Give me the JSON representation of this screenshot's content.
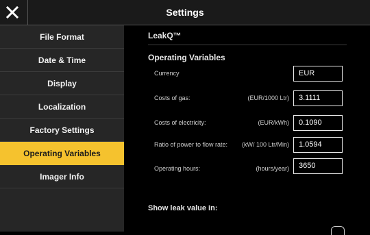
{
  "header": {
    "title": "Settings"
  },
  "sidebar": {
    "items": [
      {
        "label": "File Format"
      },
      {
        "label": "Date & Time"
      },
      {
        "label": "Display"
      },
      {
        "label": "Localization"
      },
      {
        "label": "Factory Settings"
      },
      {
        "label": "Operating Variables"
      },
      {
        "label": "Imager Info"
      }
    ],
    "active_index": 5
  },
  "content": {
    "product": "LeakQ™",
    "section_title": "Operating Variables",
    "fields": [
      {
        "label": "Currency",
        "unit": "",
        "value": "EUR"
      },
      {
        "label": "Costs of gas:",
        "unit": "(EUR/1000 Ltr)",
        "value": "3.1111"
      },
      {
        "label": "Costs of electricity:",
        "unit": "(EUR/kWh)",
        "value": "0.1090"
      },
      {
        "label": "Ratio of power to flow rate:",
        "unit": "(kW/ 100 Ltr/Min)",
        "value": "1.0594"
      },
      {
        "label": "Operating hours:",
        "unit": "(hours/year)",
        "value": "3650"
      }
    ],
    "show_leak_label": "Show leak value in:"
  },
  "colors": {
    "accent": "#f5c22e",
    "sidebar_bg": "#262626",
    "background": "#000000"
  }
}
